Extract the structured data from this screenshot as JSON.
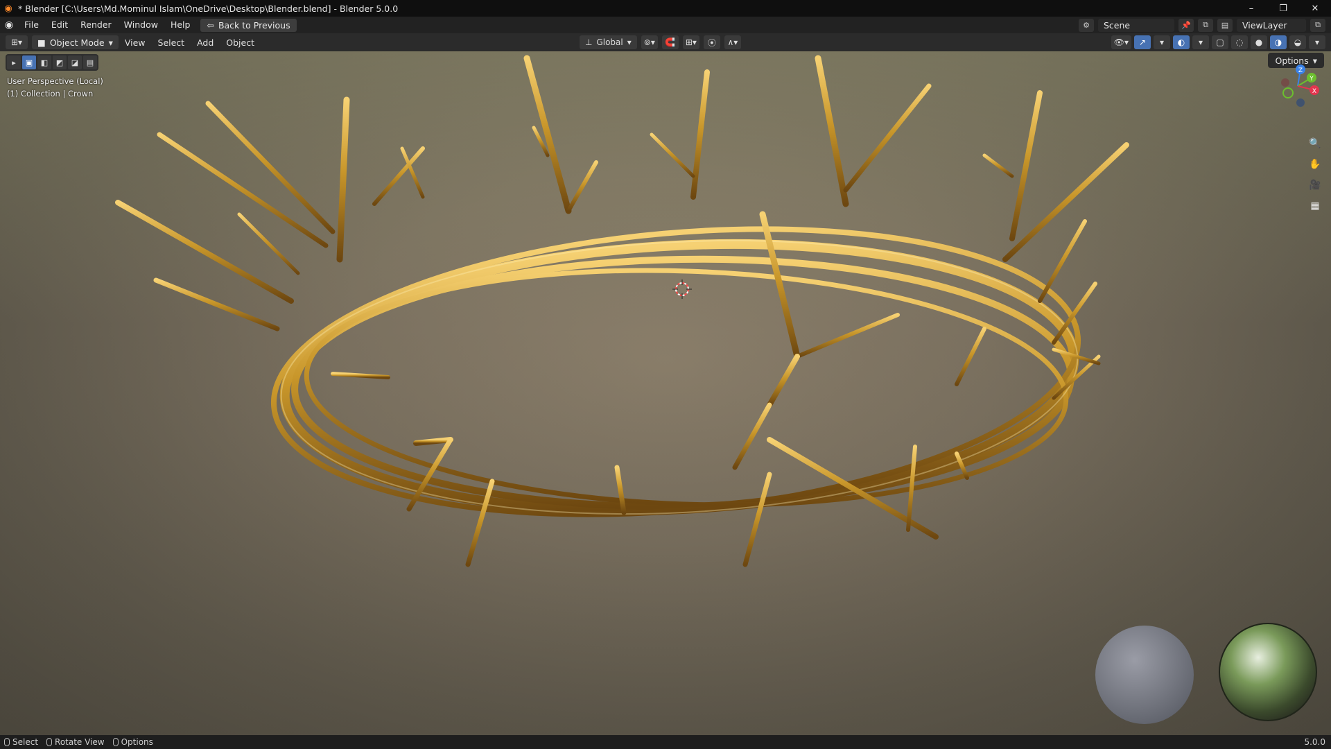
{
  "window": {
    "title": "* Blender [C:\\Users\\Md.Mominul Islam\\OneDrive\\Desktop\\Blender.blend] - Blender 5.0.0",
    "minimize": "–",
    "maximize": "❐",
    "close": "✕"
  },
  "menubar": {
    "items": [
      "File",
      "Edit",
      "Render",
      "Window",
      "Help"
    ],
    "back_label": "Back to Previous",
    "scene_label": "Scene",
    "viewlayer_label": "ViewLayer"
  },
  "viewheader": {
    "mode_label": "Object Mode",
    "menus": [
      "View",
      "Select",
      "Add",
      "Object"
    ],
    "transform_orientation": "Global"
  },
  "viewport": {
    "perspective_label": "User Perspective (Local)",
    "collection_label": "(1) Collection | Crown",
    "options_label": "Options",
    "gizmo": {
      "z": "Z",
      "y": "Y",
      "x": "X"
    }
  },
  "statusbar": {
    "select": "Select",
    "rotate": "Rotate View",
    "options": "Options",
    "version": "5.0.0"
  },
  "colors": {
    "accent": "#4772b3",
    "gold": "#c8962a",
    "gizmo_x": "#e3354f",
    "gizmo_y": "#6cbf2e",
    "gizmo_z": "#3a82e8"
  }
}
